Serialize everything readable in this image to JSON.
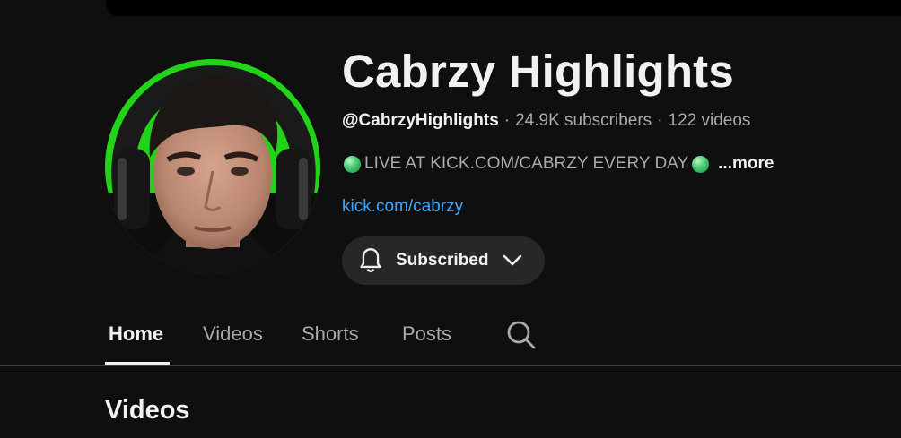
{
  "channel": {
    "title": "Cabrzy Highlights",
    "handle": "@CabrzyHighlights",
    "subscribers": "24.9K subscribers",
    "videos_count": "122 videos",
    "separator": "·",
    "description": "LIVE AT KICK.COM/CABRZY EVERY DAY",
    "more_label": "...more",
    "link": "kick.com/cabrzy"
  },
  "subscribe_button": {
    "label": "Subscribed",
    "icon": "bell-icon",
    "dropdown_icon": "chevron-down-icon"
  },
  "tabs": [
    {
      "label": "Home",
      "active": true
    },
    {
      "label": "Videos",
      "active": false
    },
    {
      "label": "Shorts",
      "active": false
    },
    {
      "label": "Posts",
      "active": false
    }
  ],
  "search_icon": "search-icon",
  "section": {
    "title": "Videos"
  },
  "colors": {
    "background": "#0f0f0f",
    "text_primary": "#f1f1f1",
    "text_secondary": "#aaaaaa",
    "link": "#3ea6ff",
    "button_bg": "#272727",
    "avatar_green": "#22d31a"
  }
}
